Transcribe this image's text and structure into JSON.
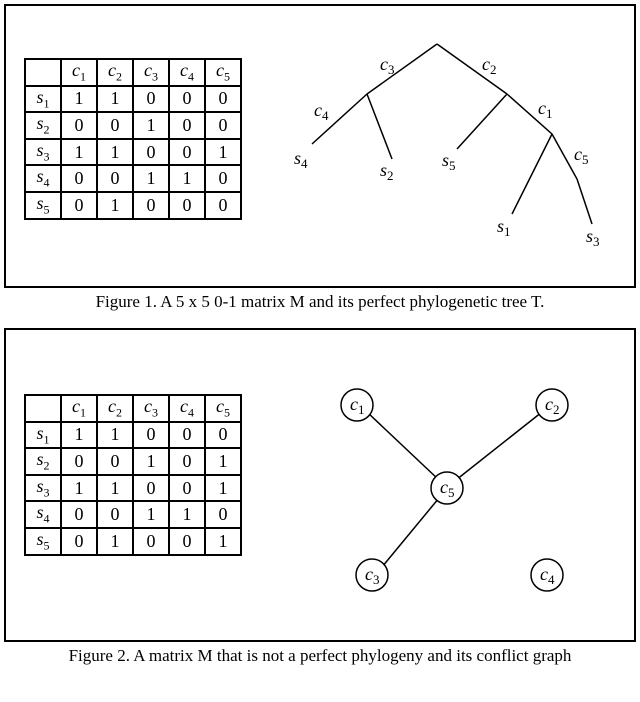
{
  "figure1": {
    "caption": "Figure 1. A 5 x 5 0-1 matrix M and its perfect phylogenetic tree T.",
    "matrix": {
      "columns": [
        "c1",
        "c2",
        "c3",
        "c4",
        "c5"
      ],
      "rows": [
        {
          "label": "s1",
          "values": [
            "1",
            "1",
            "0",
            "0",
            "0"
          ]
        },
        {
          "label": "s2",
          "values": [
            "0",
            "0",
            "1",
            "0",
            "0"
          ]
        },
        {
          "label": "s3",
          "values": [
            "1",
            "1",
            "0",
            "0",
            "1"
          ]
        },
        {
          "label": "s4",
          "values": [
            "0",
            "0",
            "1",
            "1",
            "0"
          ]
        },
        {
          "label": "s5",
          "values": [
            "0",
            "1",
            "0",
            "0",
            "0"
          ]
        }
      ]
    },
    "tree": {
      "edge_labels": {
        "l1": "c3",
        "l2": "c2",
        "l3": "c4",
        "l4": "c1",
        "l5": "c5"
      },
      "leaf_labels": {
        "a": "s4",
        "b": "s2",
        "c": "s5",
        "d": "s1",
        "e": "s3"
      }
    }
  },
  "figure2": {
    "caption": "Figure 2. A matrix M that is not a perfect phylogeny and its conflict graph",
    "matrix": {
      "columns": [
        "c1",
        "c2",
        "c3",
        "c4",
        "c5"
      ],
      "rows": [
        {
          "label": "s1",
          "values": [
            "1",
            "1",
            "0",
            "0",
            "0"
          ]
        },
        {
          "label": "s2",
          "values": [
            "0",
            "0",
            "1",
            "0",
            "1"
          ]
        },
        {
          "label": "s3",
          "values": [
            "1",
            "1",
            "0",
            "0",
            "1"
          ]
        },
        {
          "label": "s4",
          "values": [
            "0",
            "0",
            "1",
            "1",
            "0"
          ]
        },
        {
          "label": "s5",
          "values": [
            "0",
            "1",
            "0",
            "0",
            "1"
          ]
        }
      ]
    },
    "graph": {
      "nodes": [
        "c1",
        "c2",
        "c3",
        "c4",
        "c5"
      ],
      "edges": [
        [
          "c1",
          "c5"
        ],
        [
          "c2",
          "c5"
        ],
        [
          "c3",
          "c5"
        ]
      ]
    }
  }
}
